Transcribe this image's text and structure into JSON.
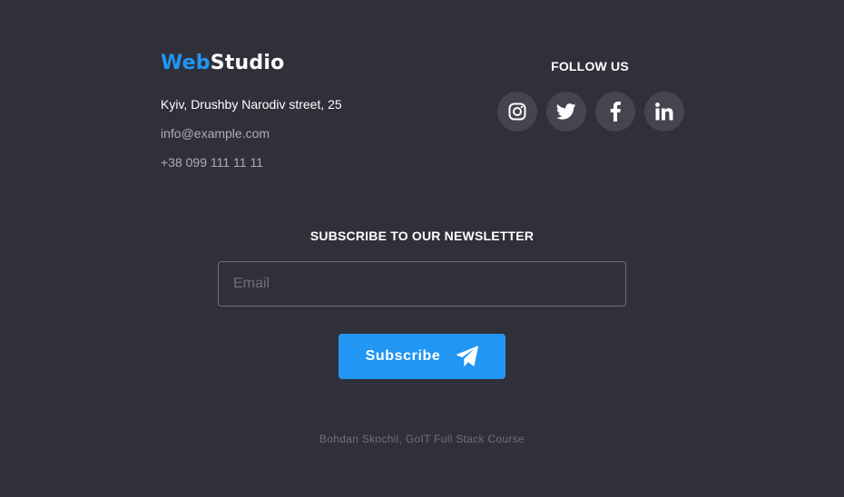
{
  "logo": {
    "part1": "Web",
    "part2": "Studio",
    "accent_color": "#2196f3"
  },
  "contacts": {
    "address": "Kyiv, Drushby Narodiv street, 25",
    "email": "info@example.com",
    "phone": "+38 099 111 11 11"
  },
  "follow": {
    "title": "FOLLOW US",
    "socials": [
      {
        "icon": "instagram-icon"
      },
      {
        "icon": "twitter-icon"
      },
      {
        "icon": "facebook-icon"
      },
      {
        "icon": "linkedin-icon"
      }
    ]
  },
  "newsletter": {
    "title": "SUBSCRIBE TO OUR NEWSLETTER",
    "email_placeholder": "Email",
    "email_value": "",
    "button_label": "Subscribe",
    "button_icon": "paper-plane-icon",
    "button_color": "#2196f3"
  },
  "copyright": "Bohdan Skochii, GoIT Full Stack Course",
  "colors": {
    "background": "#2f303a"
  }
}
